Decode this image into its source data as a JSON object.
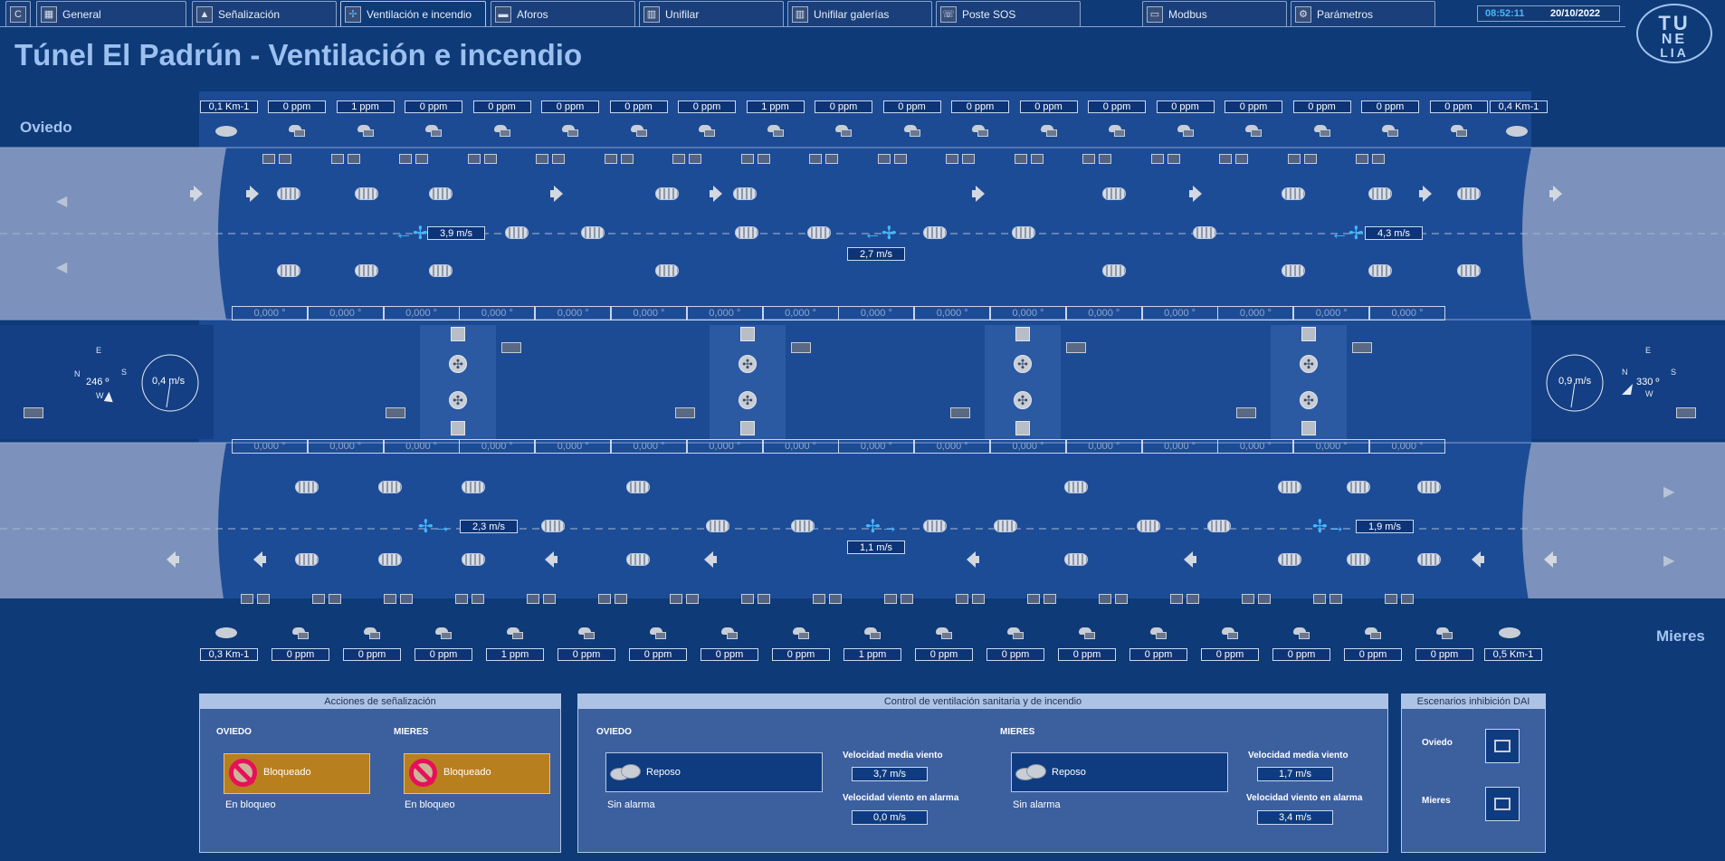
{
  "tabs": [
    {
      "label": "",
      "icon": "c-logo-icon"
    },
    {
      "label": "General",
      "icon": "grid-icon"
    },
    {
      "label": "Señalización",
      "icon": "sign-icon"
    },
    {
      "label": "Ventilación e incendio",
      "icon": "fan-icon"
    },
    {
      "label": "Aforos",
      "icon": "car-icon"
    },
    {
      "label": "Unifilar",
      "icon": "diagram-icon"
    },
    {
      "label": "Unifilar galerías",
      "icon": "diagram-icon"
    },
    {
      "label": "Poste SOS",
      "icon": "phone-icon"
    },
    {
      "label": "Modbus",
      "icon": "monitor-icon"
    },
    {
      "label": "Parámetros",
      "icon": "gear-icon"
    }
  ],
  "clock": {
    "time": "08:52:11",
    "date": "20/10/2022"
  },
  "logo": {
    "line1": "TU",
    "line2": "NE",
    "line3": "LIA"
  },
  "title": "Túnel El Padrún - Ventilación e incendio",
  "sides": {
    "left": "Oviedo",
    "right": "Mieres"
  },
  "top_tube": {
    "km_left": "0,1 Km-1",
    "km_right": "0,4 Km-1",
    "ppm": [
      "0 ppm",
      "1 ppm",
      "0 ppm",
      "0 ppm",
      "0 ppm",
      "0 ppm",
      "0 ppm",
      "1 ppm",
      "0 ppm",
      "0 ppm",
      "0 ppm",
      "0 ppm",
      "0 ppm",
      "0 ppm",
      "0 ppm",
      "0 ppm",
      "0 ppm",
      "0 ppm"
    ],
    "fan_speeds": [
      "3,9 m/s",
      "2,7 m/s",
      "4,3 m/s"
    ],
    "angles": [
      "0,000 °",
      "0,000 °",
      "0,000 °",
      "0,000 °",
      "0,000 °",
      "0,000 °",
      "0,000 °",
      "0,000 °",
      "0,000 °",
      "0,000 °",
      "0,000 °",
      "0,000 °",
      "0,000 °",
      "0,000 °",
      "0,000 °",
      "0,000 °"
    ]
  },
  "bottom_tube": {
    "km_left": "0,3 Km-1",
    "km_right": "0,5 Km-1",
    "ppm": [
      "0 ppm",
      "0 ppm",
      "0 ppm",
      "1 ppm",
      "0 ppm",
      "0 ppm",
      "0 ppm",
      "0 ppm",
      "1 ppm",
      "0 ppm",
      "0 ppm",
      "0 ppm",
      "0 ppm",
      "0 ppm",
      "0 ppm",
      "0 ppm",
      "0 ppm"
    ],
    "fan_speeds": [
      "2,3 m/s",
      "1,1 m/s",
      "1,9 m/s"
    ],
    "angles": [
      "0,000 °",
      "0,000 °",
      "0,000 °",
      "0,000 °",
      "0,000 °",
      "0,000 °",
      "0,000 °",
      "0,000 °",
      "0,000 °",
      "0,000 °",
      "0,000 °",
      "0,000 °",
      "0,000 °",
      "0,000 °",
      "0,000 °",
      "0,000 °"
    ]
  },
  "wind_left": {
    "deg": "246 º",
    "speed": "0,4 m/s",
    "compass": {
      "n": "N",
      "e": "E",
      "s": "S",
      "w": "W"
    }
  },
  "wind_right": {
    "deg": "330 º",
    "speed": "0,9 m/s",
    "compass": {
      "n": "N",
      "e": "E",
      "s": "S",
      "w": "W"
    }
  },
  "panels": {
    "senal": {
      "title": "Acciones de señalización",
      "oviedo": {
        "label": "OVIEDO",
        "state": "Bloqueado",
        "sub": "En bloqueo"
      },
      "mieres": {
        "label": "MIERES",
        "state": "Bloqueado",
        "sub": "En bloqueo"
      }
    },
    "vent": {
      "title": "Control de ventilación sanitaria y de incendio",
      "oviedo": {
        "label": "OVIEDO",
        "state": "Reposo",
        "sub": "Sin alarma",
        "vm_label": "Velocidad media viento",
        "vm": "3,7 m/s",
        "va_label": "Velocidad viento en alarma",
        "va": "0,0 m/s"
      },
      "mieres": {
        "label": "MIERES",
        "state": "Reposo",
        "sub": "Sin alarma",
        "vm_label": "Velocidad media viento",
        "vm": "1,7 m/s",
        "va_label": "Velocidad viento en alarma",
        "va": "3,4 m/s"
      }
    },
    "dai": {
      "title": "Escenarios inhibición DAI",
      "oviedo": "Oviedo",
      "mieres": "Mieres"
    }
  },
  "colors": {
    "background": "#0e3a78",
    "tube": "#1c4b94",
    "fan_active": "#44b8ff",
    "blocked": "#b87f1f",
    "no_entry": "#e8105a",
    "clock_time": "#4bb7ff"
  }
}
